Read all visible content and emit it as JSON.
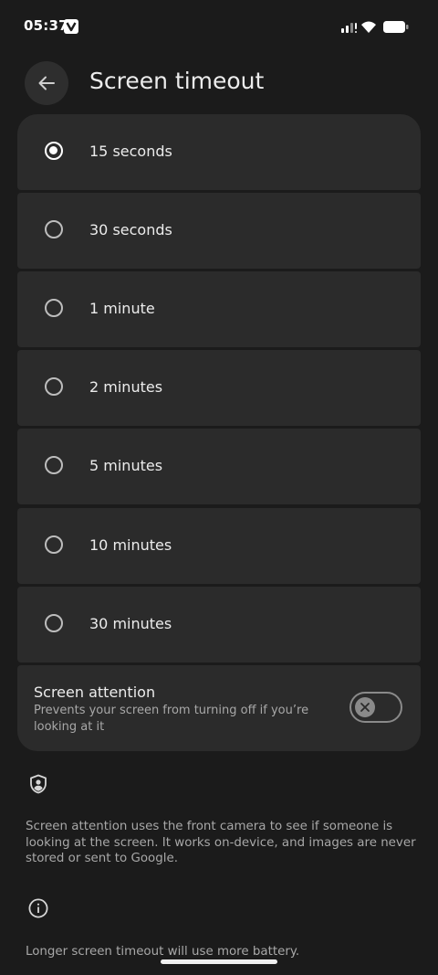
{
  "status_bar": {
    "time": "05:37",
    "icons": [
      "v-badge-icon",
      "signal-icon",
      "wifi-icon",
      "battery-icon"
    ]
  },
  "header": {
    "title": "Screen timeout",
    "back_icon": "arrow-left-icon"
  },
  "options": [
    {
      "label": "15 seconds",
      "selected": true
    },
    {
      "label": "30 seconds",
      "selected": false
    },
    {
      "label": "1 minute",
      "selected": false
    },
    {
      "label": "2 minutes",
      "selected": false
    },
    {
      "label": "5 minutes",
      "selected": false
    },
    {
      "label": "10 minutes",
      "selected": false
    },
    {
      "label": "30 minutes",
      "selected": false
    }
  ],
  "screen_attention": {
    "title": "Screen attention",
    "description": "Prevents your screen from turning off if you’re looking at it",
    "enabled": false
  },
  "footer": {
    "privacy_icon": "shield-person-icon",
    "privacy_text": "Screen attention uses the front camera to see if someone is looking at the screen. It works on-device, and images are never stored or sent to Google.",
    "info_icon": "info-icon",
    "info_text": "Longer screen timeout will use more battery."
  },
  "colors": {
    "background": "#1b1b1b",
    "card": "#2b2b2b",
    "text_primary": "#ececec",
    "text_secondary": "#a8a8a8"
  }
}
